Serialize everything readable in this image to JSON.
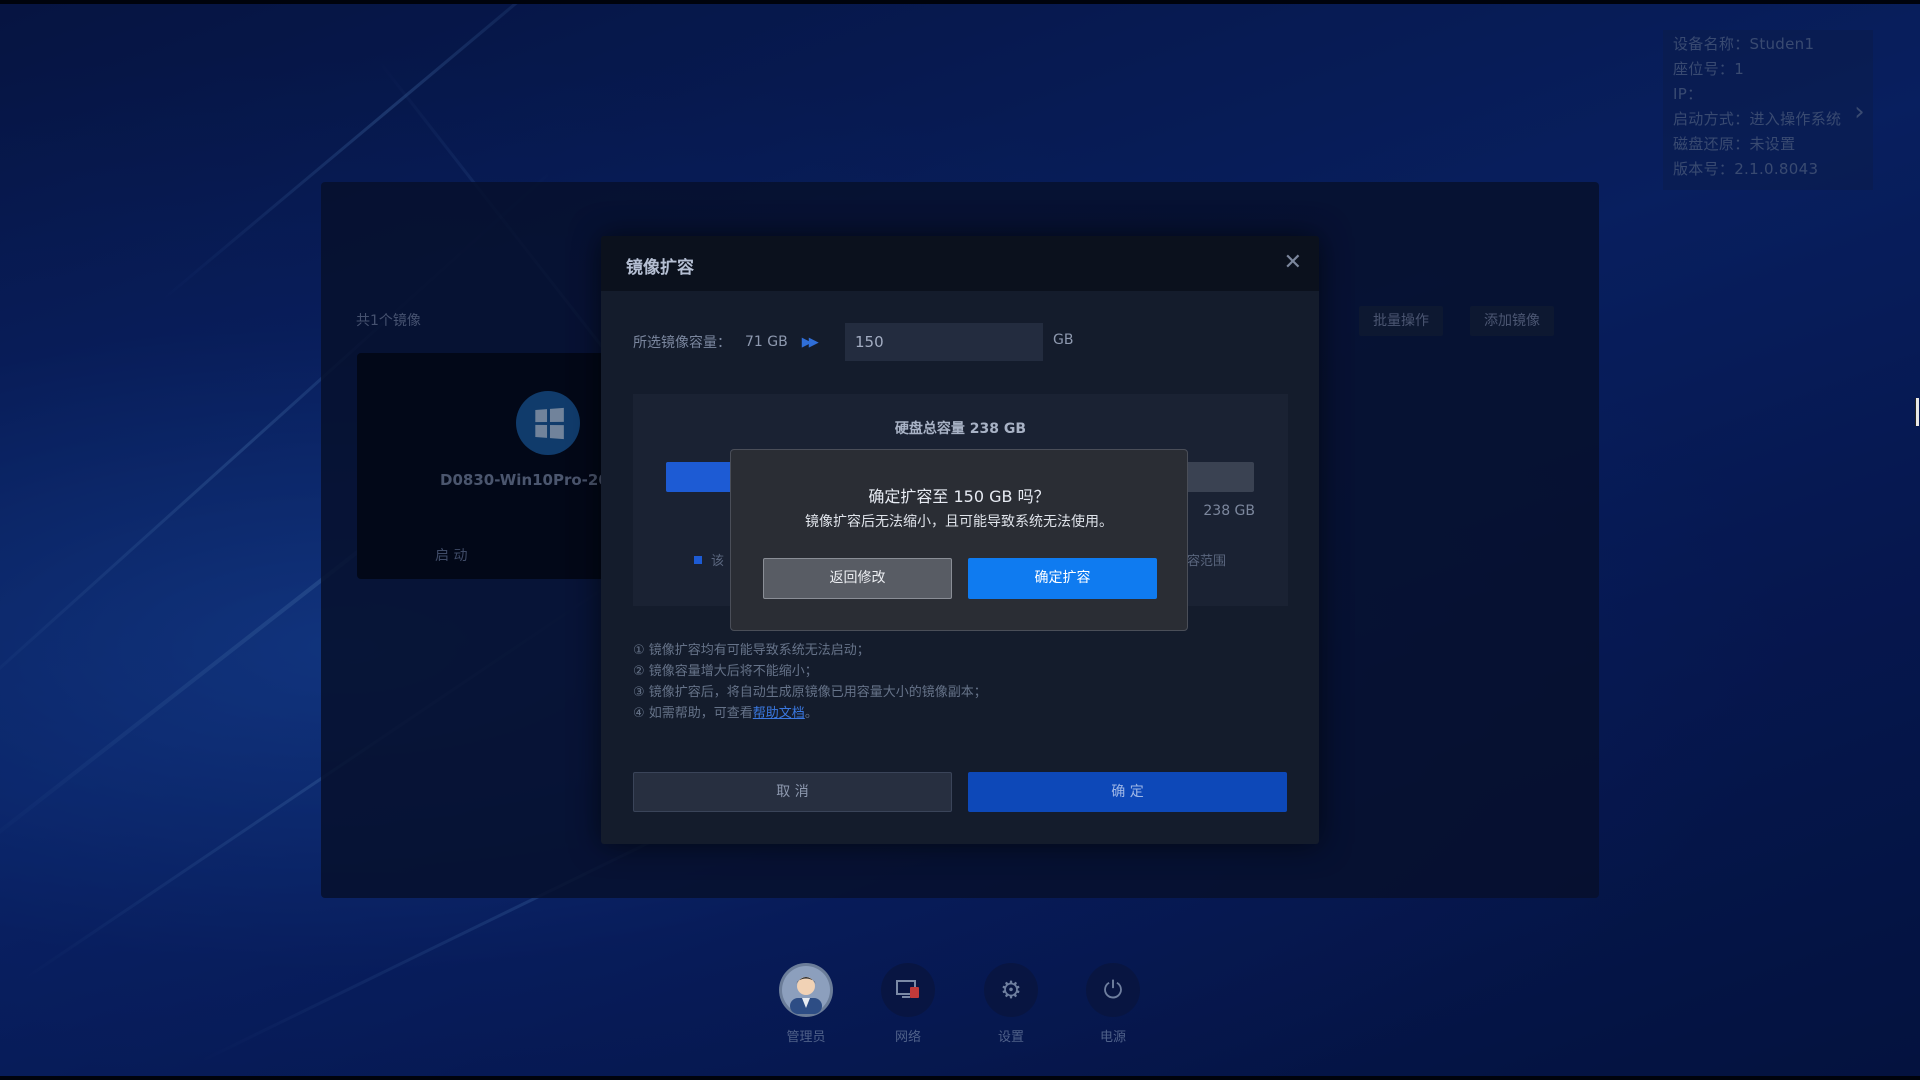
{
  "device_info": {
    "lines": [
      "设备名称：Studen1",
      "座位号：1",
      "IP：",
      "启动方式：进入操作系统",
      "磁盘还原：未设置",
      "版本号：2.1.0.8043"
    ]
  },
  "main_panel": {
    "count_label": "共1个镜像",
    "batch_button": "批量操作",
    "add_button": "添加镜像",
    "card": {
      "name": "D0830-Win10Pro-20",
      "start_label": "启 动"
    }
  },
  "expand_dialog": {
    "title": "镜像扩容",
    "capacity_label": "所选镜像容量：",
    "current_capacity": "71 GB",
    "new_capacity_value": "150",
    "unit": "GB",
    "disk_title": "硬盘总容量 238 GB",
    "disk_total_label": "238 GB",
    "disk_used_fraction": 0.3,
    "legend_left": "该",
    "legend_right": "容范围",
    "notes": [
      "① 镜像扩容均有可能导致系统无法启动；",
      "② 镜像容量增大后将不能缩小；",
      "③ 镜像扩容后，将自动生成原镜像已用容量大小的镜像副本；"
    ],
    "note4_prefix": "④ 如需帮助，可查看",
    "note4_link": "帮助文档",
    "note4_suffix": "。",
    "cancel": "取 消",
    "ok": "确 定"
  },
  "confirm_dialog": {
    "question": "确定扩容至 150 GB 吗？",
    "warning": "镜像扩容后无法缩小，且可能导致系统无法使用。",
    "back_button": "返回修改",
    "confirm_button": "确定扩容"
  },
  "dock": [
    {
      "label": "管理员",
      "icon": "avatar-icon"
    },
    {
      "label": "网络",
      "icon": "network-icon"
    },
    {
      "label": "设置",
      "icon": "gear-icon"
    },
    {
      "label": "电源",
      "icon": "power-icon"
    }
  ],
  "colors": {
    "accent": "#0f7bf0",
    "desktop": "#0a1e60",
    "dialog": "#141c2c"
  }
}
